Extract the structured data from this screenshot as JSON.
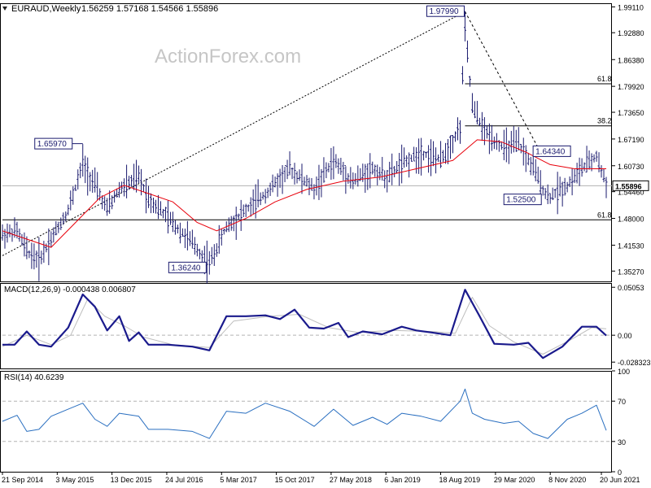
{
  "header": {
    "symbol": "EURAUD,Weekly",
    "ohlc": "1.56259 1.57168 1.54566 1.55896",
    "watermark": "ActionForex.com"
  },
  "chart_data": [
    {
      "type": "candlestick",
      "title": "EURAUD,Weekly",
      "ylim": [
        1.3277,
        2.0
      ],
      "y_ticks": [
        "1.99110",
        "1.92880",
        "1.86380",
        "1.79920",
        "1.73650",
        "1.67190",
        "1.60730",
        "1.54460",
        "1.48000",
        "1.41530",
        "1.35270"
      ],
      "y_tick_values": [
        1.9911,
        1.9288,
        1.8638,
        1.7992,
        1.7365,
        1.6719,
        1.6073,
        1.5446,
        1.48,
        1.4153,
        1.3527
      ],
      "current_price_label": "1.55896",
      "current_price": 1.55896,
      "moving_average_color": "#e8000b",
      "price_color": "#1a1a6e",
      "path_points": [
        {
          "t": 0,
          "v": 1.44
        },
        {
          "t": 6,
          "v": 1.45
        },
        {
          "t": 10,
          "v": 1.4
        },
        {
          "t": 15,
          "v": 1.38
        },
        {
          "t": 20,
          "v": 1.43
        },
        {
          "t": 27,
          "v": 1.5
        },
        {
          "t": 33,
          "v": 1.61
        },
        {
          "t": 38,
          "v": 1.56
        },
        {
          "t": 43,
          "v": 1.5
        },
        {
          "t": 48,
          "v": 1.55
        },
        {
          "t": 56,
          "v": 1.58
        },
        {
          "t": 60,
          "v": 1.53
        },
        {
          "t": 68,
          "v": 1.48
        },
        {
          "t": 78,
          "v": 1.42
        },
        {
          "t": 85,
          "v": 1.37
        },
        {
          "t": 92,
          "v": 1.46
        },
        {
          "t": 100,
          "v": 1.5
        },
        {
          "t": 108,
          "v": 1.54
        },
        {
          "t": 118,
          "v": 1.6
        },
        {
          "t": 128,
          "v": 1.55
        },
        {
          "t": 136,
          "v": 1.62
        },
        {
          "t": 144,
          "v": 1.57
        },
        {
          "t": 152,
          "v": 1.6
        },
        {
          "t": 158,
          "v": 1.58
        },
        {
          "t": 164,
          "v": 1.61
        },
        {
          "t": 172,
          "v": 1.64
        },
        {
          "t": 180,
          "v": 1.62
        },
        {
          "t": 188,
          "v": 1.7
        },
        {
          "t": 190,
          "v": 1.94
        },
        {
          "t": 193,
          "v": 1.75
        },
        {
          "t": 198,
          "v": 1.69
        },
        {
          "t": 206,
          "v": 1.65
        },
        {
          "t": 212,
          "v": 1.66
        },
        {
          "t": 218,
          "v": 1.6
        },
        {
          "t": 224,
          "v": 1.53
        },
        {
          "t": 232,
          "v": 1.56
        },
        {
          "t": 238,
          "v": 1.6
        },
        {
          "t": 244,
          "v": 1.63
        },
        {
          "t": 248,
          "v": 1.56
        }
      ],
      "ma_points": [
        {
          "t": 0,
          "v": 1.45
        },
        {
          "t": 10,
          "v": 1.43
        },
        {
          "t": 20,
          "v": 1.41
        },
        {
          "t": 30,
          "v": 1.47
        },
        {
          "t": 40,
          "v": 1.53
        },
        {
          "t": 50,
          "v": 1.56
        },
        {
          "t": 60,
          "v": 1.54
        },
        {
          "t": 70,
          "v": 1.52
        },
        {
          "t": 80,
          "v": 1.47
        },
        {
          "t": 88,
          "v": 1.45
        },
        {
          "t": 100,
          "v": 1.48
        },
        {
          "t": 112,
          "v": 1.52
        },
        {
          "t": 125,
          "v": 1.55
        },
        {
          "t": 140,
          "v": 1.57
        },
        {
          "t": 155,
          "v": 1.58
        },
        {
          "t": 170,
          "v": 1.6
        },
        {
          "t": 185,
          "v": 1.62
        },
        {
          "t": 195,
          "v": 1.67
        },
        {
          "t": 205,
          "v": 1.665
        },
        {
          "t": 215,
          "v": 1.64
        },
        {
          "t": 225,
          "v": 1.61
        },
        {
          "t": 235,
          "v": 1.6
        },
        {
          "t": 248,
          "v": 1.6
        }
      ],
      "price_labels": [
        {
          "text": "1.97990",
          "t": 190,
          "v": 1.9799
        },
        {
          "text": "1.65970",
          "t": 33,
          "v": 1.6597
        },
        {
          "text": "1.64340",
          "t": 233,
          "v": 1.6434
        },
        {
          "text": "1.52500",
          "t": 221,
          "v": 1.525
        },
        {
          "text": "1.36240",
          "t": 82,
          "v": 1.3624
        }
      ],
      "horizontal_levels": [
        {
          "label": "61.8",
          "v": 1.8055
        },
        {
          "label": "38.2",
          "v": 1.7037
        },
        {
          "label": "61.8",
          "v": 1.4765
        }
      ],
      "trend_lines": [
        {
          "from": {
            "t": 0,
            "v": 1.39
          },
          "to": {
            "t": 190,
            "v": 1.9799
          },
          "style": "dotted"
        },
        {
          "from": {
            "t": 190,
            "v": 1.9799
          },
          "to": {
            "t": 221,
            "v": 1.64
          },
          "style": "dashed"
        }
      ]
    },
    {
      "type": "line",
      "title": "MACD(12,26,9) -0.000438 0.006807",
      "ylim": [
        -0.035,
        0.055
      ],
      "y_ticks": [
        "0.05053",
        "0.00",
        "-0.028323"
      ],
      "y_tick_values": [
        0.05053,
        0.0,
        -0.028323
      ],
      "series": [
        {
          "color": "#1a1a8c",
          "points": [
            {
              "t": 0,
              "v": -0.01
            },
            {
              "t": 5,
              "v": -0.01
            },
            {
              "t": 10,
              "v": 0.004
            },
            {
              "t": 15,
              "v": -0.01
            },
            {
              "t": 20,
              "v": -0.012
            },
            {
              "t": 27,
              "v": 0.008
            },
            {
              "t": 33,
              "v": 0.043
            },
            {
              "t": 38,
              "v": 0.03
            },
            {
              "t": 43,
              "v": 0.005
            },
            {
              "t": 48,
              "v": 0.02
            },
            {
              "t": 52,
              "v": -0.006
            },
            {
              "t": 56,
              "v": 0.003
            },
            {
              "t": 60,
              "v": -0.01
            },
            {
              "t": 68,
              "v": -0.01
            },
            {
              "t": 78,
              "v": -0.012
            },
            {
              "t": 85,
              "v": -0.016
            },
            {
              "t": 92,
              "v": 0.02
            },
            {
              "t": 100,
              "v": 0.02
            },
            {
              "t": 108,
              "v": 0.021
            },
            {
              "t": 114,
              "v": 0.017
            },
            {
              "t": 120,
              "v": 0.027
            },
            {
              "t": 126,
              "v": 0.008
            },
            {
              "t": 132,
              "v": 0.007
            },
            {
              "t": 138,
              "v": 0.013
            },
            {
              "t": 142,
              "v": -0.002
            },
            {
              "t": 148,
              "v": 0.004
            },
            {
              "t": 156,
              "v": 0.001
            },
            {
              "t": 164,
              "v": 0.009
            },
            {
              "t": 170,
              "v": 0.005
            },
            {
              "t": 176,
              "v": 0.003
            },
            {
              "t": 184,
              "v": 0.0
            },
            {
              "t": 190,
              "v": 0.048
            },
            {
              "t": 196,
              "v": 0.02
            },
            {
              "t": 202,
              "v": -0.009
            },
            {
              "t": 210,
              "v": -0.01
            },
            {
              "t": 216,
              "v": -0.008
            },
            {
              "t": 222,
              "v": -0.024
            },
            {
              "t": 230,
              "v": -0.012
            },
            {
              "t": 238,
              "v": 0.009
            },
            {
              "t": 244,
              "v": 0.009
            },
            {
              "t": 248,
              "v": -0.0004
            }
          ]
        },
        {
          "color": "#bdbdbd",
          "points": [
            {
              "t": 0,
              "v": -0.012
            },
            {
              "t": 10,
              "v": 0.0
            },
            {
              "t": 20,
              "v": -0.01
            },
            {
              "t": 28,
              "v": 0.0
            },
            {
              "t": 35,
              "v": 0.038
            },
            {
              "t": 42,
              "v": 0.02
            },
            {
              "t": 50,
              "v": 0.01
            },
            {
              "t": 58,
              "v": -0.002
            },
            {
              "t": 70,
              "v": -0.01
            },
            {
              "t": 85,
              "v": -0.013
            },
            {
              "t": 95,
              "v": 0.015
            },
            {
              "t": 110,
              "v": 0.02
            },
            {
              "t": 122,
              "v": 0.022
            },
            {
              "t": 134,
              "v": 0.008
            },
            {
              "t": 146,
              "v": 0.003
            },
            {
              "t": 160,
              "v": 0.005
            },
            {
              "t": 176,
              "v": 0.004
            },
            {
              "t": 186,
              "v": 0.002
            },
            {
              "t": 193,
              "v": 0.04
            },
            {
              "t": 200,
              "v": 0.01
            },
            {
              "t": 210,
              "v": -0.007
            },
            {
              "t": 222,
              "v": -0.02
            },
            {
              "t": 234,
              "v": -0.004
            },
            {
              "t": 242,
              "v": 0.008
            },
            {
              "t": 248,
              "v": 0.0068
            }
          ]
        }
      ]
    },
    {
      "type": "line",
      "title": "RSI(14) 40.6239",
      "ylim": [
        0,
        100
      ],
      "y_ticks": [
        "100",
        "70",
        "30",
        "0"
      ],
      "y_tick_values": [
        100,
        70,
        30,
        0
      ],
      "x_ticks": [
        "21 Sep 2014",
        "3 May 2015",
        "13 Dec 2015",
        "24 Jul 2016",
        "5 Mar 2017",
        "15 Oct 2017",
        "27 May 2018",
        "6 Jan 2019",
        "18 Aug 2019",
        "29 Mar 2020",
        "8 Nov 2020",
        "20 Jun 2021"
      ],
      "x_tick_t": [
        0,
        22.5,
        45,
        67.5,
        90,
        112.5,
        135,
        157.5,
        180,
        202.5,
        225,
        246
      ],
      "series": [
        {
          "color": "#2a6fc0",
          "points": [
            {
              "t": 0,
              "v": 50
            },
            {
              "t": 6,
              "v": 56
            },
            {
              "t": 10,
              "v": 40
            },
            {
              "t": 15,
              "v": 42
            },
            {
              "t": 20,
              "v": 55
            },
            {
              "t": 27,
              "v": 62
            },
            {
              "t": 33,
              "v": 68
            },
            {
              "t": 38,
              "v": 52
            },
            {
              "t": 43,
              "v": 45
            },
            {
              "t": 48,
              "v": 58
            },
            {
              "t": 56,
              "v": 55
            },
            {
              "t": 60,
              "v": 42
            },
            {
              "t": 68,
              "v": 42
            },
            {
              "t": 78,
              "v": 40
            },
            {
              "t": 85,
              "v": 33
            },
            {
              "t": 92,
              "v": 60
            },
            {
              "t": 100,
              "v": 58
            },
            {
              "t": 108,
              "v": 68
            },
            {
              "t": 118,
              "v": 60
            },
            {
              "t": 128,
              "v": 45
            },
            {
              "t": 136,
              "v": 62
            },
            {
              "t": 144,
              "v": 46
            },
            {
              "t": 152,
              "v": 54
            },
            {
              "t": 158,
              "v": 47
            },
            {
              "t": 164,
              "v": 58
            },
            {
              "t": 172,
              "v": 55
            },
            {
              "t": 180,
              "v": 50
            },
            {
              "t": 188,
              "v": 70
            },
            {
              "t": 190,
              "v": 82
            },
            {
              "t": 193,
              "v": 58
            },
            {
              "t": 198,
              "v": 52
            },
            {
              "t": 206,
              "v": 48
            },
            {
              "t": 212,
              "v": 50
            },
            {
              "t": 218,
              "v": 38
            },
            {
              "t": 224,
              "v": 33
            },
            {
              "t": 232,
              "v": 52
            },
            {
              "t": 238,
              "v": 58
            },
            {
              "t": 244,
              "v": 66
            },
            {
              "t": 248,
              "v": 41
            }
          ]
        }
      ]
    }
  ]
}
